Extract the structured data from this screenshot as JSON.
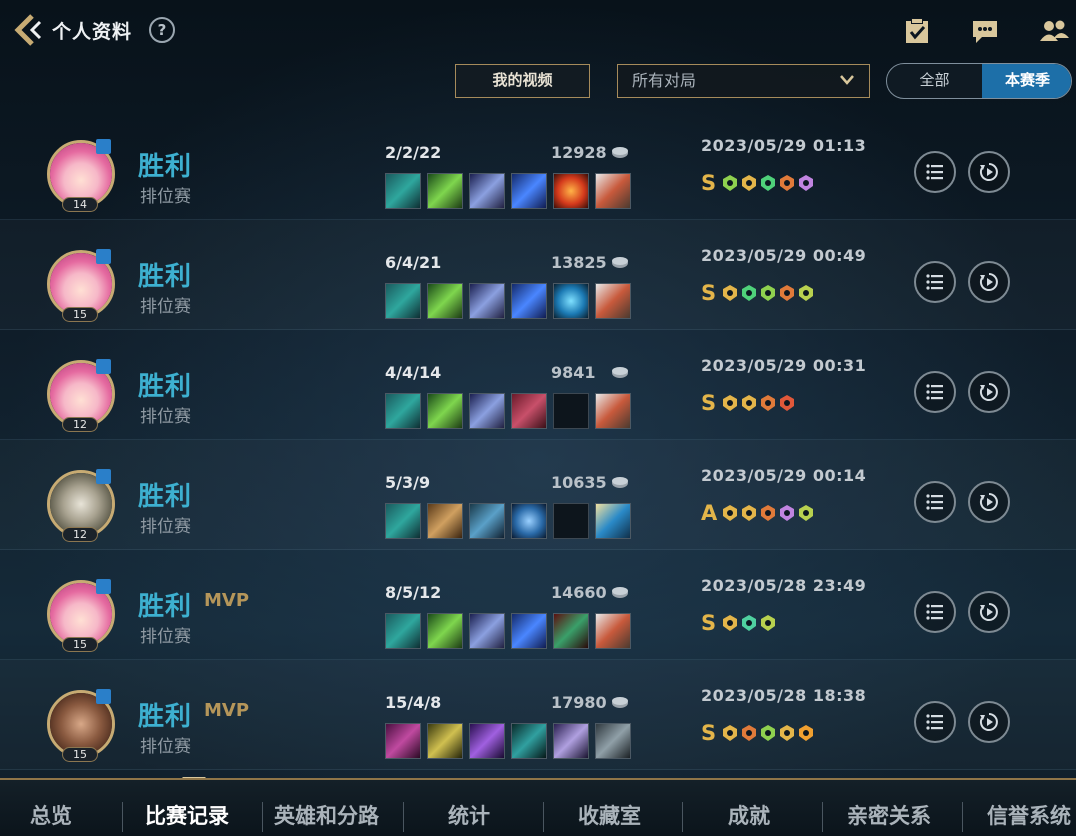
{
  "header": {
    "title": "个人资料",
    "help_label": "?"
  },
  "filters": {
    "video_button": "我的视频",
    "match_select_value": "所有对局",
    "toggle_all": "全部",
    "toggle_season": "本赛季"
  },
  "matches": [
    {
      "result": "胜利",
      "mvp": "",
      "mode": "排位赛",
      "level": "14",
      "kda": "2/2/22",
      "gold": "12928",
      "time": "2023/05/29 01:13",
      "grade": "S",
      "avatar": "pink"
    },
    {
      "result": "胜利",
      "mvp": "",
      "mode": "排位赛",
      "level": "15",
      "kda": "6/4/21",
      "gold": "13825",
      "time": "2023/05/29 00:49",
      "grade": "S",
      "avatar": "pink"
    },
    {
      "result": "胜利",
      "mvp": "",
      "mode": "排位赛",
      "level": "12",
      "kda": "4/4/14",
      "gold": "9841",
      "time": "2023/05/29 00:31",
      "grade": "S",
      "avatar": "pink"
    },
    {
      "result": "胜利",
      "mvp": "",
      "mode": "排位赛",
      "level": "12",
      "kda": "5/3/9",
      "gold": "10635",
      "time": "2023/05/29 00:14",
      "grade": "A",
      "avatar": "armor"
    },
    {
      "result": "胜利",
      "mvp": "MVP",
      "mode": "排位赛",
      "level": "15",
      "kda": "8/5/12",
      "gold": "14660",
      "time": "2023/05/28 23:49",
      "grade": "S",
      "avatar": "pink"
    },
    {
      "result": "胜利",
      "mvp": "MVP",
      "mode": "排位赛",
      "level": "15",
      "kda": "15/4/8",
      "gold": "17980",
      "time": "2023/05/28 18:38",
      "grade": "S",
      "avatar": "brown"
    }
  ],
  "nav": {
    "items": [
      "总览",
      "比赛记录",
      "英雄和分路",
      "统计",
      "收藏室",
      "成就",
      "亲密关系",
      "信誉系统"
    ],
    "active": "比赛记录"
  },
  "colors": {
    "accent_gold": "#c7ab73",
    "win_blue": "#3db0d0",
    "toggle_active": "#1d6fa8",
    "grade_gold": "#e3b54a"
  },
  "icons": {
    "header": [
      "back-icon",
      "help-icon",
      "task-icon",
      "chat-icon",
      "friends-icon"
    ],
    "row": [
      "gold-coin-icon",
      "list-icon",
      "replay-icon"
    ]
  }
}
